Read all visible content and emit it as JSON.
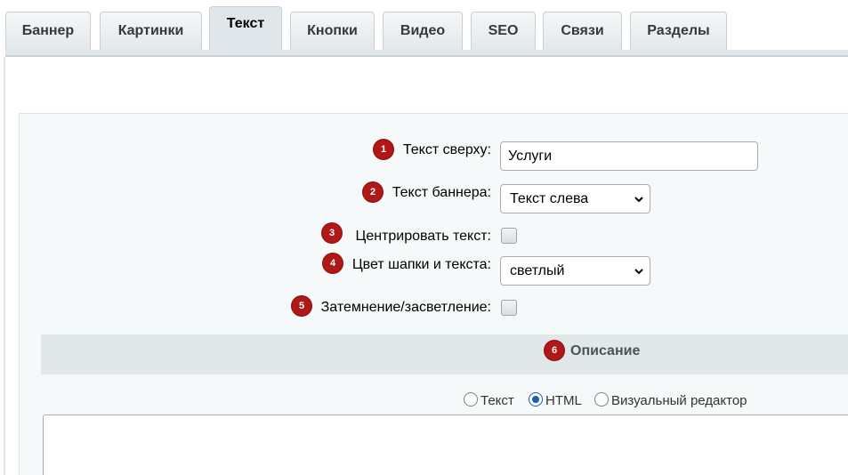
{
  "tabs": [
    {
      "label": "Баннер",
      "active": false
    },
    {
      "label": "Картинки",
      "active": false
    },
    {
      "label": "Текст",
      "active": true
    },
    {
      "label": "Кнопки",
      "active": false
    },
    {
      "label": "Видео",
      "active": false
    },
    {
      "label": "SEO",
      "active": false
    },
    {
      "label": "Связи",
      "active": false
    },
    {
      "label": "Разделы",
      "active": false
    }
  ],
  "form": {
    "top_text": {
      "badge": "1",
      "label": "Текст сверху:",
      "value": "Услуги"
    },
    "banner_text": {
      "badge": "2",
      "label": "Текст баннера:",
      "value": "Текст слева"
    },
    "center_text": {
      "badge": "3",
      "label": "Центрировать текст:",
      "checked": false
    },
    "header_color": {
      "badge": "4",
      "label": "Цвет шапки и текста:",
      "value": "светлый"
    },
    "dim_light": {
      "badge": "5",
      "label": "Затемнение/засветление:",
      "checked": false
    }
  },
  "description": {
    "badge": "6",
    "title": "Описание",
    "modes": [
      {
        "label": "Текст",
        "checked": false
      },
      {
        "label": "HTML",
        "checked": true
      },
      {
        "label": "Визуальный редактор",
        "checked": false
      }
    ],
    "content": ""
  },
  "colors": {
    "badge": "#b01717",
    "tab_active": "#e0e7ea",
    "panel": "#f5f9f9",
    "section_header": "#e0e8ea"
  }
}
